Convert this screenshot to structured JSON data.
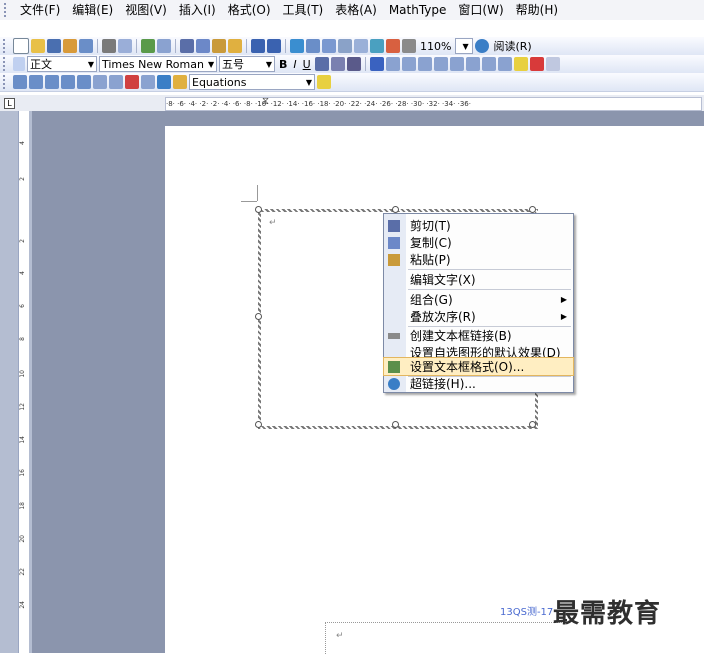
{
  "menubar": {
    "items": [
      "文件(F)",
      "编辑(E)",
      "视图(V)",
      "插入(I)",
      "格式(O)",
      "工具(T)",
      "表格(A)",
      "MathType",
      "窗口(W)",
      "帮助(H)"
    ]
  },
  "toolbar": {
    "zoom": "110%",
    "reading_label": "阅读(R)",
    "style_value": "正文",
    "font_value": "Times New Roman",
    "size_value": "五号",
    "equations_value": "Equations",
    "bold_label": "B",
    "italic_label": "I",
    "underline_label": "U"
  },
  "ruler": {
    "ticks": "·8·  ·6·  ·4·  ·2·        ·2·  ·4·  ·6·  ·8·  ·10·  ·12·  ·14·  ·16·  ·18·  ·20·  ·22·  ·24·  ·26·  ·28·  ·30·  ·32·  ·34·  ·36·"
  },
  "vruler_ticks": [
    "4",
    "2",
    "2",
    "4",
    "6",
    "8",
    "10",
    "12",
    "14",
    "16",
    "18",
    "20",
    "22",
    "24"
  ],
  "context_menu": {
    "items": [
      {
        "label": "剪切(T)",
        "icon": "scissors-icon",
        "color": "#5a6ea8"
      },
      {
        "label": "复制(C)",
        "icon": "copy-icon",
        "color": "#6c88c8"
      },
      {
        "label": "粘贴(P)",
        "icon": "paste-icon",
        "color": "#c99a3a"
      },
      {
        "label": "编辑文字(X)",
        "icon": "",
        "color": ""
      },
      {
        "label": "组合(G)",
        "icon": "",
        "color": "",
        "submenu": true
      },
      {
        "label": "叠放次序(R)",
        "icon": "",
        "color": "",
        "submenu": true
      },
      {
        "label": "创建文本框链接(B)",
        "icon": "link-icon",
        "color": "#8a8a8a"
      },
      {
        "label": "设置自选图形的默认效果(D)",
        "icon": "",
        "color": ""
      },
      {
        "label": "设置文本框格式(O)...",
        "icon": "format-textbox-icon",
        "color": "#5b8f4a",
        "highlighted": true
      },
      {
        "label": "超链接(H)...",
        "icon": "hyperlink-icon",
        "color": "#3a7ec6"
      }
    ]
  },
  "footer": {
    "page_text": "13QS测-17"
  },
  "watermark": {
    "text": "最需教育"
  },
  "colors": {
    "gray_area": "#8b95ad",
    "menu_highlight": "#ffeec2"
  }
}
